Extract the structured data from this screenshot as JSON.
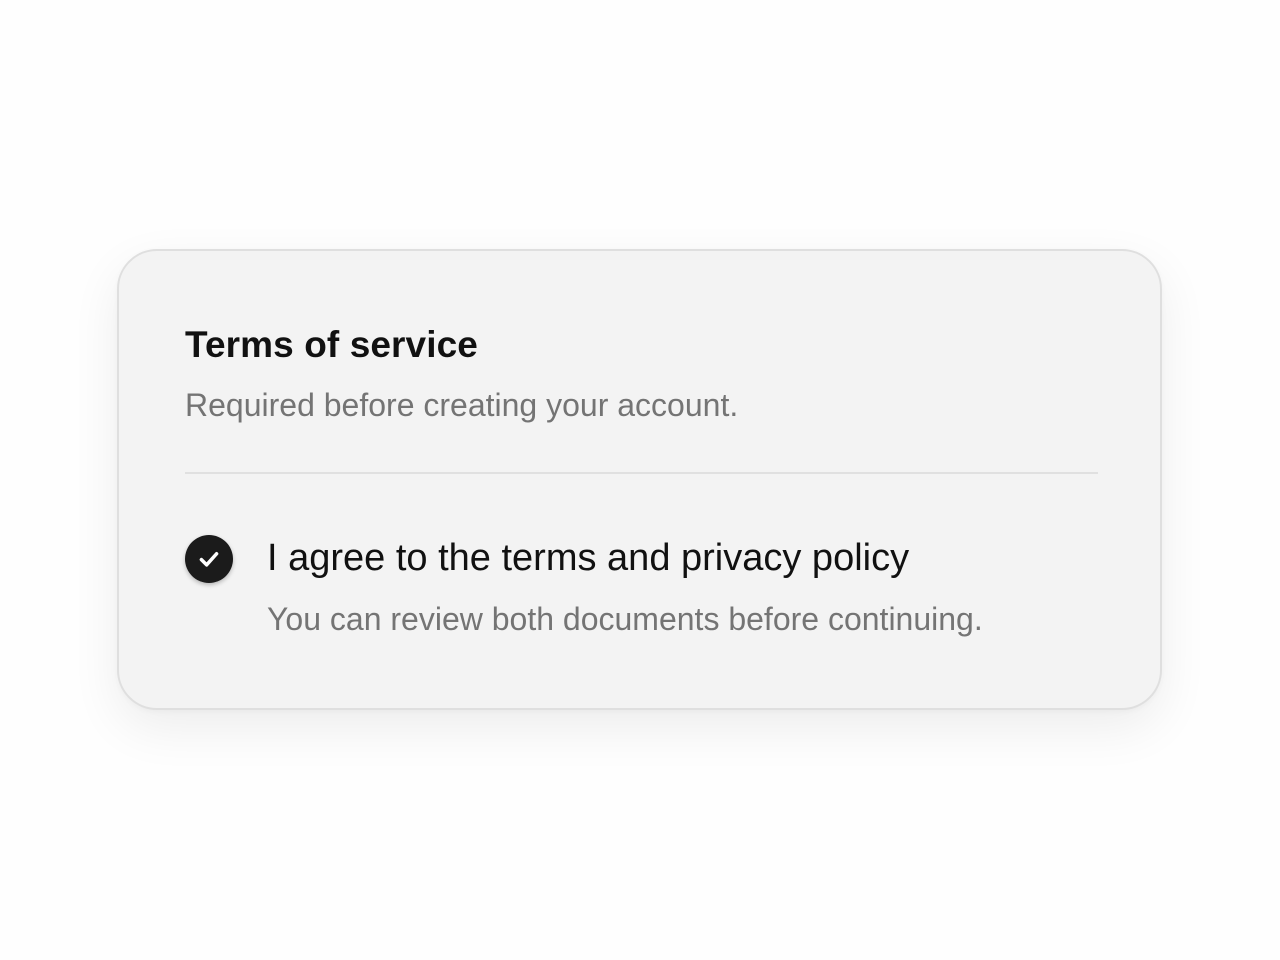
{
  "card": {
    "title": "Terms of service",
    "subtitle": "Required before creating your account."
  },
  "agreement": {
    "checked": true,
    "icon": "check-icon",
    "label": "I agree to the terms and privacy policy",
    "help": "You can review both documents before continuing."
  },
  "colors": {
    "card_background": "#f3f3f3",
    "checkbox_fill": "#1b1b1b",
    "primary_text": "#111111",
    "secondary_text": "#747474"
  }
}
